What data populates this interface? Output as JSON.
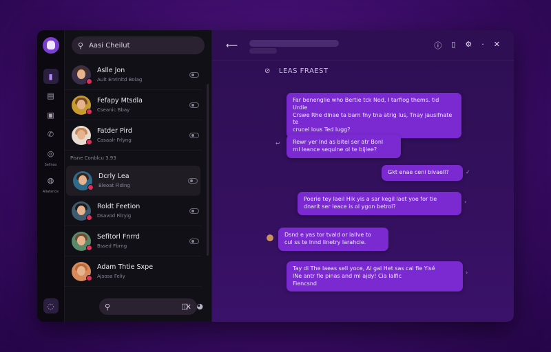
{
  "search": {
    "query": "Aasi Cheilut"
  },
  "rail": {
    "items": [
      {
        "icon": "bar-icon",
        "label": ""
      },
      {
        "icon": "document-icon",
        "label": ""
      },
      {
        "icon": "image-icon",
        "label": ""
      },
      {
        "icon": "phone-icon",
        "label": ""
      },
      {
        "icon": "chat-icon",
        "label": "Sellnas"
      },
      {
        "icon": "globe-icon",
        "label": "Aliatence"
      }
    ]
  },
  "contacts": [
    {
      "name": "Aslle Jon",
      "sub": "Ault Enrinltd Bolag"
    },
    {
      "name": "Fefapy Mtsdla",
      "sub": "Cseanic Bbay"
    },
    {
      "name": "Fatder Pird",
      "sub": "Casaalr Frlyng"
    }
  ],
  "section_label": "Pisne Conblcu   3.93",
  "contacts2": [
    {
      "name": "Dcrly Lea",
      "sub": "Bleoat Flding"
    },
    {
      "name": "Roldt Feetion",
      "sub": "Dsavod Filryig"
    },
    {
      "name": "Sefitorl Fnrrd",
      "sub": "Bssed Fbrng"
    },
    {
      "name": "Adam Thtie Sxpe",
      "sub": "Ajsosa Feliy"
    }
  ],
  "chat": {
    "title": "LEAS FRAEST",
    "messages": [
      {
        "text": "Far benenglie who Bertie tck Nod, I tarfiog thems. tid Urdie\nCrswe Rhe dlnae ta barn fny tna atrig lus, Tnay jausifnate te\ncrucel lous Ted lugg?",
        "side": "out"
      },
      {
        "text": "Rewr yer lnd as bitel ser atr Bonl\nrnl leance sequine ol te bijlee?",
        "side": "out"
      },
      {
        "text": "Gkt enae ceni bivaell?",
        "side": "out"
      },
      {
        "text": "Poerie tey laeil Hik yis a sar kegil laet yoe for tie\ndnarit ser leace is ol ygon betrol?",
        "side": "out"
      },
      {
        "text": "Dsnd e yas tor tvald or lallve to\ncul ss te lnnd linetry larahcie.",
        "side": "in"
      },
      {
        "text": "Tay di The laeas sell yoce, Al gal Het sas cal fie Yisé\nlNe antr fle pinas and ml ajdy!             Cia lalfic\nFiencsnd",
        "side": "out"
      }
    ]
  },
  "colors": {
    "accent": "#7a2ad0",
    "badge": "#e0305a"
  }
}
